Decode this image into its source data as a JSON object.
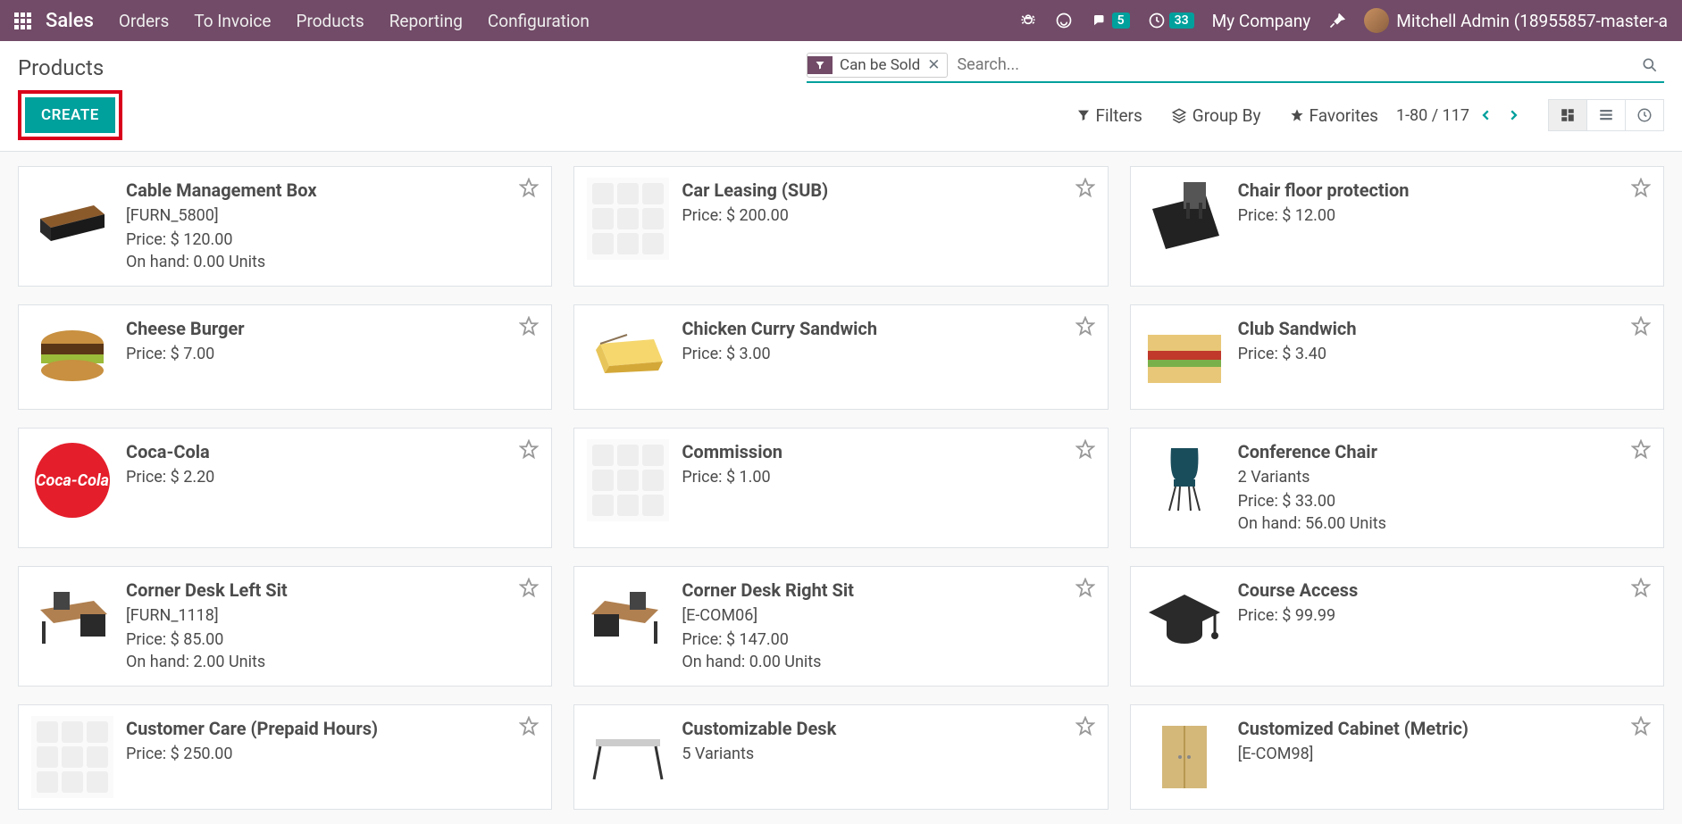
{
  "nav": {
    "brand": "Sales",
    "links": [
      "Orders",
      "To Invoice",
      "Products",
      "Reporting",
      "Configuration"
    ],
    "messaging_badge": "5",
    "activities_badge": "33",
    "company": "My Company",
    "user": "Mitchell Admin (18955857-master-a"
  },
  "header": {
    "title": "Products",
    "create_label": "CREATE"
  },
  "search": {
    "facet_label": "Can be Sold",
    "placeholder": "Search...",
    "filters_label": "Filters",
    "groupby_label": "Group By",
    "favorites_label": "Favorites"
  },
  "pager": {
    "range": "1-80 / 117"
  },
  "products": [
    {
      "name": "Cable Management Box",
      "ref": "[FURN_5800]",
      "price": "Price: $ 120.00",
      "onhand": "On hand: 0.00 Units",
      "img": "box"
    },
    {
      "name": "Car Leasing (SUB)",
      "ref": "",
      "price": "Price: $ 200.00",
      "onhand": "",
      "img": "placeholder"
    },
    {
      "name": "Chair floor protection",
      "ref": "",
      "price": "Price: $ 12.00",
      "onhand": "",
      "img": "mat"
    },
    {
      "name": "Cheese Burger",
      "ref": "",
      "price": "Price: $ 7.00",
      "onhand": "",
      "img": "burger"
    },
    {
      "name": "Chicken Curry Sandwich",
      "ref": "",
      "price": "Price: $ 3.00",
      "onhand": "",
      "img": "sandwich"
    },
    {
      "name": "Club Sandwich",
      "ref": "",
      "price": "Price: $ 3.40",
      "onhand": "",
      "img": "club"
    },
    {
      "name": "Coca-Cola",
      "ref": "",
      "price": "Price: $ 2.20",
      "onhand": "",
      "img": "cola"
    },
    {
      "name": "Commission",
      "ref": "",
      "price": "Price: $ 1.00",
      "onhand": "",
      "img": "placeholder"
    },
    {
      "name": "Conference Chair",
      "ref": "",
      "price": "Price: $ 33.00",
      "onhand": "On hand: 56.00 Units",
      "img": "chair",
      "variants": "2 Variants"
    },
    {
      "name": "Corner Desk Left Sit",
      "ref": "[FURN_1118]",
      "price": "Price: $ 85.00",
      "onhand": "On hand: 2.00 Units",
      "img": "deskL"
    },
    {
      "name": "Corner Desk Right Sit",
      "ref": "[E-COM06]",
      "price": "Price: $ 147.00",
      "onhand": "On hand: 0.00 Units",
      "img": "deskR"
    },
    {
      "name": "Course Access",
      "ref": "",
      "price": "Price: $ 99.99",
      "onhand": "",
      "img": "cap"
    },
    {
      "name": "Customer Care (Prepaid Hours)",
      "ref": "",
      "price": "Price: $ 250.00",
      "onhand": "",
      "img": "placeholder"
    },
    {
      "name": "Customizable Desk",
      "ref": "",
      "price": "",
      "onhand": "",
      "img": "desk",
      "variants": "5 Variants"
    },
    {
      "name": "Customized Cabinet (Metric)",
      "ref": "[E-COM98]",
      "price": "",
      "onhand": "",
      "img": "cabinet"
    }
  ]
}
